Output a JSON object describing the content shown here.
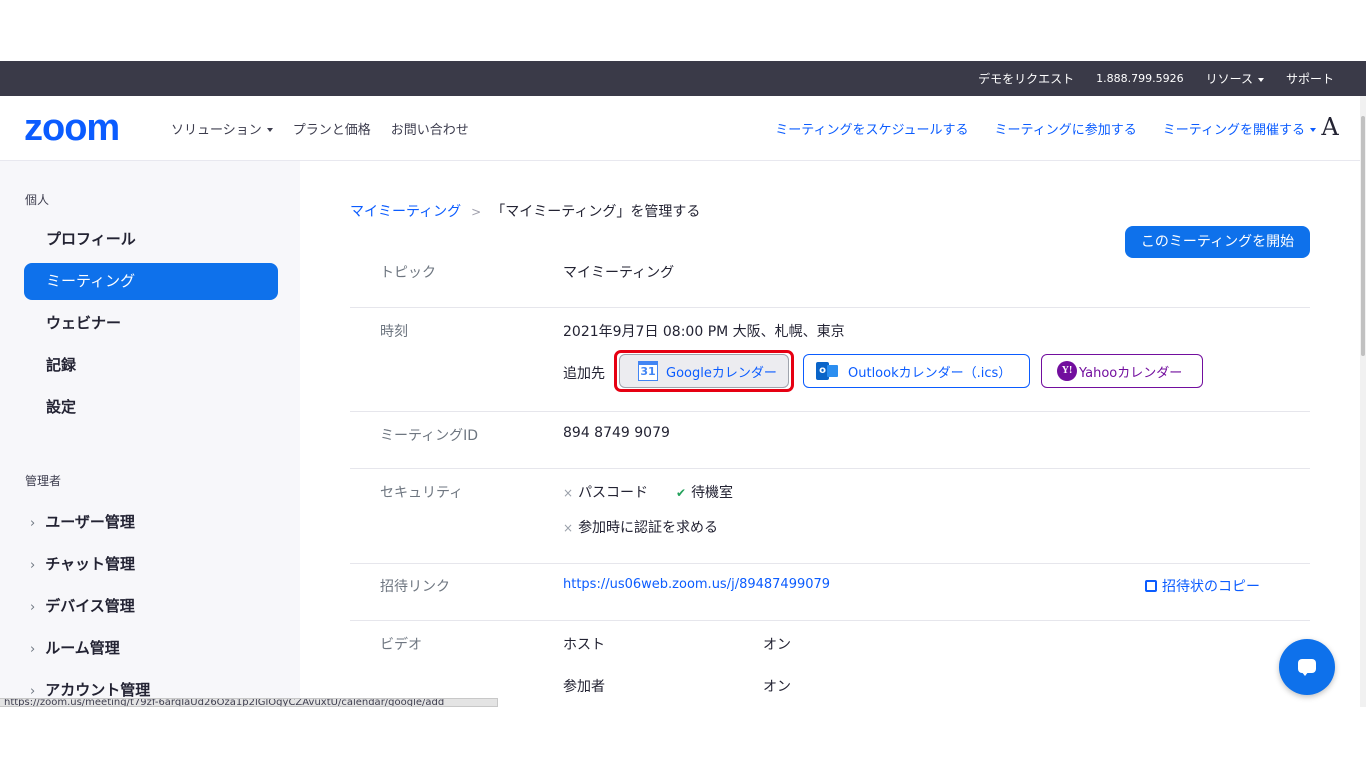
{
  "utility_bar": {
    "request_demo": "デモをリクエスト",
    "phone": "1.888.799.5926",
    "resources": "リソース",
    "support": "サポート"
  },
  "nav": {
    "logo": "zoom",
    "solutions": "ソリューション",
    "plans": "プランと価格",
    "contact": "お問い合わせ",
    "schedule": "ミーティングをスケジュールする",
    "join": "ミーティングに参加する",
    "host": "ミーティングを開催する",
    "avatar_letter": "A"
  },
  "sidebar": {
    "personal_heading": "個人",
    "items": [
      "プロフィール",
      "ミーティング",
      "ウェビナー",
      "記録",
      "設定"
    ],
    "active_index": 1,
    "admin_heading": "管理者",
    "admin_groups": [
      "ユーザー管理",
      "チャット管理",
      "デバイス管理",
      "ルーム管理",
      "アカウント管理"
    ],
    "status_url": "https://zoom.us/meeting/t79zf-6arqIaUd26Oza1p2lGlOgyCZAvuxtU/calendar/google/add"
  },
  "breadcrumb": {
    "parent": "マイミーティング",
    "current": "「マイミーティング」を管理する"
  },
  "start_button": "このミーティングを開始",
  "details": {
    "topic_label": "トピック",
    "topic_value": "マイミーティング",
    "time_label": "時刻",
    "time_value": "2021年9月7日 08:00 PM 大阪、札幌、東京",
    "add_to_label": "追加先",
    "google_calendar": "Googleカレンダー",
    "google_icon_text": "31",
    "outlook_calendar": "Outlookカレンダー（.ics）",
    "outlook_icon_text": "o",
    "yahoo_calendar": "Yahooカレンダー",
    "yahoo_icon_text": "Y!",
    "meeting_id_label": "ミーティングID",
    "meeting_id_value": "894 8749 9079",
    "security_label": "セキュリティ",
    "security_passcode": "パスコード",
    "security_waiting_room": "待機室",
    "security_auth": "参加時に認証を求める",
    "invite_label": "招待リンク",
    "invite_link": "https://us06web.zoom.us/j/89487499079",
    "copy_invite": "招待状のコピー",
    "video_label": "ビデオ",
    "video_host_label": "ホスト",
    "video_host_value": "オン",
    "video_participant_label": "参加者",
    "video_participant_value": "オン"
  },
  "colors": {
    "brand_blue": "#0b5cff",
    "active_blue": "#0e71eb",
    "highlight_red": "#e60012",
    "yahoo_purple": "#720e9e"
  }
}
